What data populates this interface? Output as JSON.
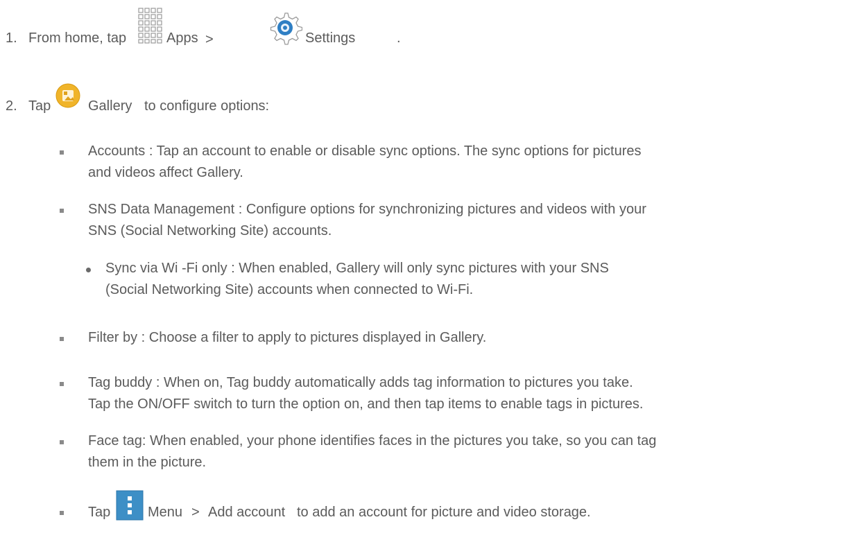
{
  "step1": {
    "number": "1.",
    "prefix": "From home, tap",
    "apps_label": "Apps",
    "separator": ">",
    "settings_label": "Settings",
    "period": "."
  },
  "step2": {
    "number": "2.",
    "prefix": "Tap",
    "gallery_label": "Gallery",
    "suffix": "to configure options:"
  },
  "bullets": [
    {
      "term": "Accounts",
      "desc_line1": " : Tap an account to enable or disable sync options. The sync options for pictures",
      "desc_line2": "and videos affect Gallery."
    },
    {
      "term": "SNS Data Management",
      "desc_line1": " : Configure options for synchronizing pictures and videos with your",
      "desc_line2": "SNS (Social Networking Site) accounts."
    },
    {
      "term": "Filter by",
      "desc_line1": " : Choose a filter to apply to pictures displayed in Gallery."
    },
    {
      "term": "Tag buddy",
      "desc_line1": " : When on, Tag buddy automatically adds tag information to pictures you take.",
      "desc_line2": "Tap the ON/OFF switch to turn the option on, and then tap items to enable tags in pictures."
    },
    {
      "term": "Face tag",
      "desc_line1": ": When enabled, your phone identifies faces in the pictures you take, so you can tag",
      "desc_line2": "them in the picture."
    }
  ],
  "subbullet": {
    "term": "Sync via Wi -Fi only",
    "desc_line1": " : When enabled, Gallery will only sync pictures with your SNS",
    "desc_line2": "(Social Networking Site) accounts when connected to Wi-Fi."
  },
  "last_bullet": {
    "prefix": "Tap",
    "menu_label": "Menu",
    "separator": ">",
    "add_account_label": "Add account",
    "suffix": "to add an account for picture and video storage."
  },
  "colors": {
    "text": "#5b5b5b",
    "gallery_icon": "#f0b42a",
    "menu_icon": "#3d8fc6",
    "settings_icon": "#2f7fc4"
  }
}
